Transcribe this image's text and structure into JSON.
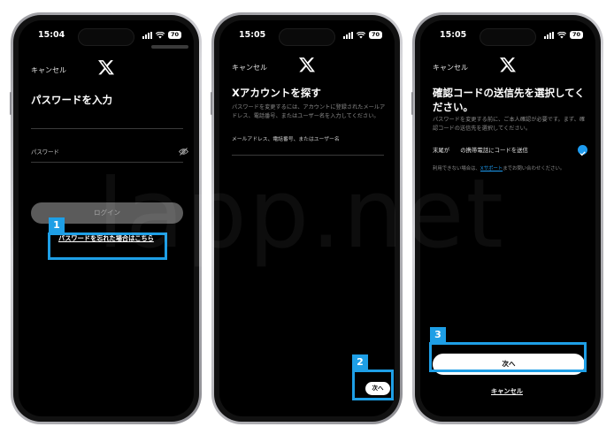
{
  "status": {
    "battery": "70"
  },
  "phone1": {
    "time": "15:04",
    "cancel": "キャンセル",
    "title": "パスワードを入力",
    "password_label": "パスワード",
    "login_button": "ログイン",
    "forgot_link": "パスワードを忘れた場合はこちら",
    "badge": "1"
  },
  "phone2": {
    "time": "15:05",
    "cancel": "キャンセル",
    "title": "Xアカウントを探す",
    "description": "パスワードを変更するには、アカウントに登録されたメールアドレス、電話番号、またはユーザー名を入力してください。",
    "input_placeholder": "メールアドレス、電話番号、またはユーザー名",
    "next_button": "次へ",
    "badge": "2"
  },
  "phone3": {
    "time": "15:05",
    "cancel": "キャンセル",
    "title": "確認コードの送信先を選択してください。",
    "description": "パスワードを変更する前に、ご本人確認が必要です。まず、確認コードの送信先を選択してください。",
    "option_prefix": "末尾が",
    "option_suffix": "の携帯電話にコードを送信",
    "help_prefix": "利用できない場合は、",
    "help_link": "Xサポート",
    "help_suffix": "までお問い合わせください。",
    "next_button": "次へ",
    "cancel_link": "キャンセル",
    "badge": "3"
  },
  "watermark": "lapp.net",
  "colors": {
    "accent": "#1e9fe6",
    "check": "#1d9bf0"
  }
}
